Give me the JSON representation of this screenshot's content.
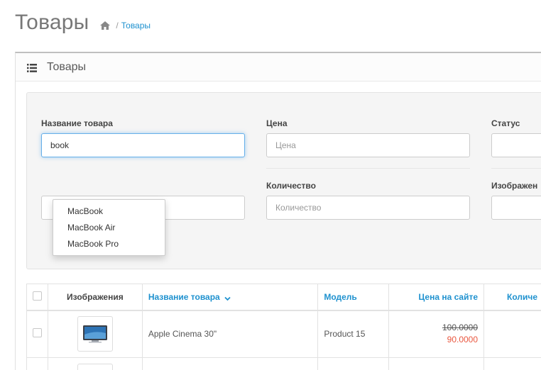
{
  "header": {
    "title": "Товары",
    "breadcrumb": {
      "home_icon": "home-icon",
      "separator": "/",
      "current": "Товары"
    }
  },
  "panel": {
    "icon": "list-icon",
    "title": "Товары"
  },
  "filter": {
    "product_name": {
      "label": "Название товара",
      "value": "book",
      "placeholder": ""
    },
    "price": {
      "label": "Цена",
      "placeholder": "Цена"
    },
    "status": {
      "label": "Статус",
      "value": ""
    },
    "quantity": {
      "label": "Количество",
      "placeholder": "Количество"
    },
    "image": {
      "label": "Изображен",
      "value": ""
    },
    "autocomplete": [
      "MacBook",
      "MacBook Air",
      "MacBook Pro"
    ]
  },
  "table": {
    "headers": {
      "image": "Изображения",
      "name": "Название товара",
      "model": "Модель",
      "price": "Цена на сайте",
      "quantity": "Количе"
    },
    "sort_icon": "chevron-down-icon",
    "rows": [
      {
        "name": "Apple Cinema 30\"",
        "model": "Product 15",
        "old_price": "100.0000",
        "price": "90.0000",
        "image_icon": "monitor-icon"
      }
    ]
  },
  "colors": {
    "link": "#1e91cf",
    "special_price": "#e9573f",
    "focus": "#66afe9"
  }
}
